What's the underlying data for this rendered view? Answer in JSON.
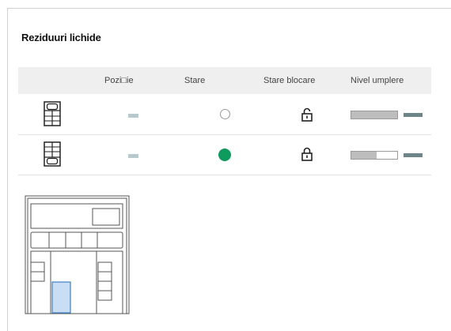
{
  "title": "Reziduuri lichide",
  "columns": {
    "position": "Pozi□ie",
    "state": "Stare",
    "lock_state": "Stare blocare",
    "fill_level": "Nivel umplere"
  },
  "rows": [
    {
      "icon": "container-top-icon",
      "state": "empty",
      "lock": "unlocked",
      "fill_fraction": 1.0
    },
    {
      "icon": "container-bottom-icon",
      "state": "active",
      "lock": "locked",
      "fill_fraction": 0.55
    }
  ],
  "colors": {
    "state_active": "#0e9c5e",
    "position_dash": "#b7c9cc",
    "fill_bar": "#bdbdbd",
    "fill_indicator": "#6d8488",
    "diagram_highlight": "#c9ddf3"
  }
}
